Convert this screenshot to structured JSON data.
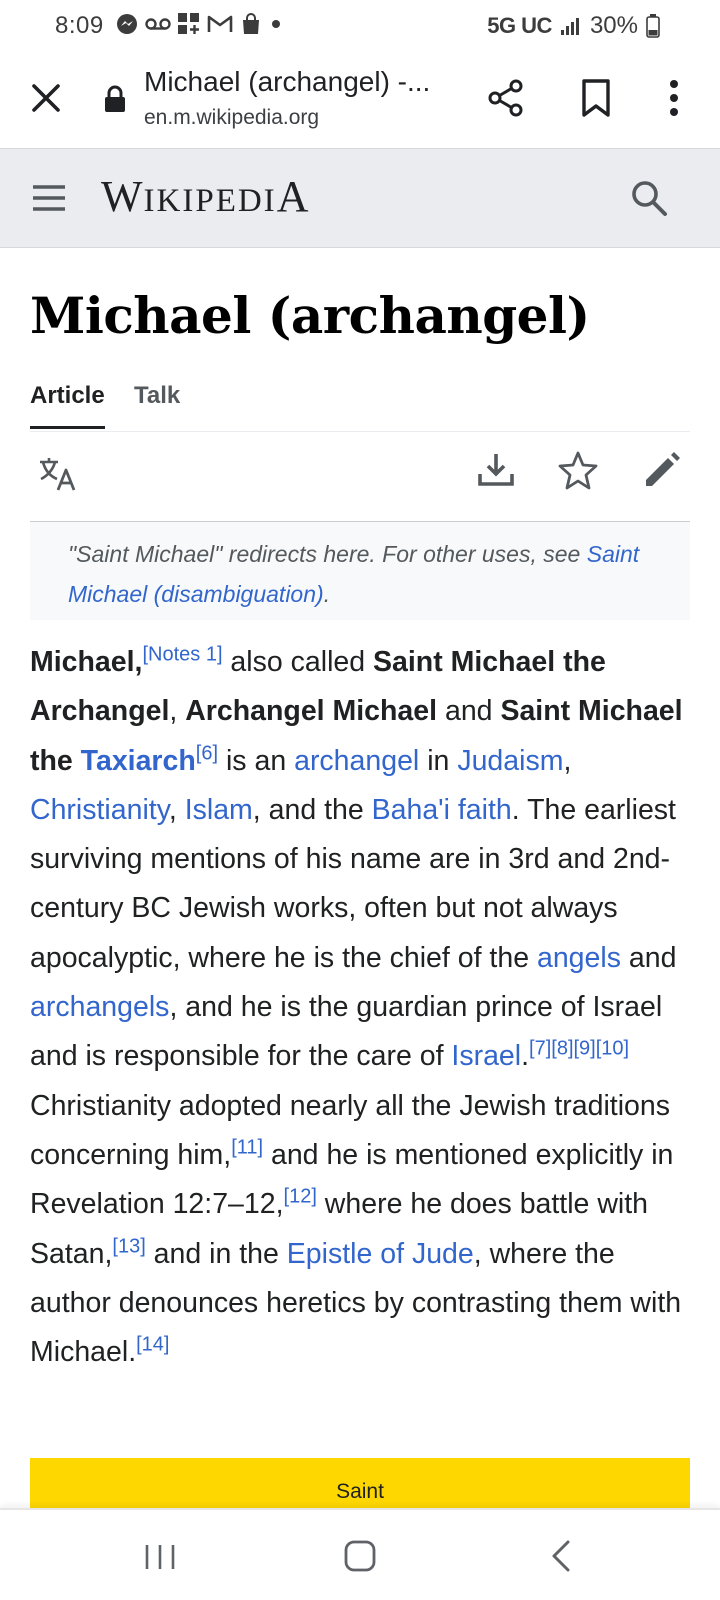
{
  "status_bar": {
    "time": "8:09",
    "network": "5G UC",
    "battery": "30%",
    "left_icons": [
      "messenger-icon",
      "voicemail-icon",
      "app-grid-icon",
      "gmail-icon",
      "shopping-bag-icon",
      "dot-icon"
    ]
  },
  "browser": {
    "tab_title": "Michael (archangel) -...",
    "url": "en.m.wikipedia.org"
  },
  "wiki": {
    "logo_first": "W",
    "logo_middle": "IKIPEDI",
    "logo_last": "A"
  },
  "page": {
    "title": "Michael (archangel)",
    "tabs": [
      "Article",
      "Talk"
    ],
    "hatnote": {
      "text": "\"Saint Michael\" redirects here. For other uses, see ",
      "link": "Saint Michael (disambiguation)",
      "end": "."
    },
    "lead": {
      "s01": "Michael,",
      "s02": "[Notes 1]",
      "s03": " also called ",
      "s04": "Saint Michael the Archangel",
      "s05": ", ",
      "s06": "Archangel Michael",
      "s07": " and ",
      "s08": "Saint Michael the ",
      "s09": "Taxiarch",
      "s10": "[6]",
      "s11": " is an ",
      "s12": "archangel",
      "s13": " in ",
      "s14": "Judaism",
      "s15": ", ",
      "s16": "Christianity",
      "s17": ", ",
      "s18": "Islam",
      "s19": ", and the ",
      "s20": "Baha'i faith",
      "s21": ". The earliest surviving mentions of his name are in 3rd and 2nd-century BC Jewish works, often but not always apocalyptic, where he is the chief of the ",
      "s22": "angels",
      "s23": " and ",
      "s24": "archangels",
      "s25": ", and he is the guardian prince of Israel and is responsible for the care of ",
      "s26": "Israel",
      "s27": ".",
      "s28": "[7][8][9][10]",
      "s29": " Christianity adopted nearly all the Jewish traditions concerning him,",
      "s30": "[11]",
      "s31": " and he is mentioned explicitly in Revelation 12:7–12,",
      "s32": "[12]",
      "s33": " where he does battle with Satan,",
      "s34": "[13]",
      "s35": " and in the ",
      "s36": "Epistle of Jude",
      "s37": ", where the author denounces heretics by contrasting them with Michael.",
      "s38": "[14]"
    },
    "infobox_header": "Saint"
  },
  "colors": {
    "link": "#3366cc",
    "header_bg": "#eaecf0",
    "infobox_bg": "#ffd700"
  }
}
